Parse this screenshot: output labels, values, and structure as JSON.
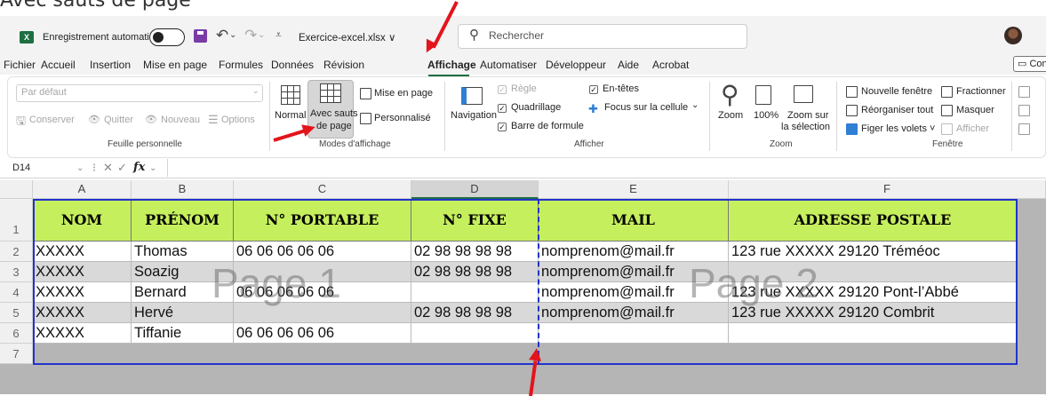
{
  "caption": "Avec sauts de page",
  "titlebar": {
    "app_icon": "X",
    "autosave_label": "Enregistrement automatique",
    "filename": "Exercice-excel.xlsx ∨",
    "search_placeholder": "Rechercher"
  },
  "menu": {
    "items": [
      "Fichier",
      "Accueil",
      "Insertion",
      "Mise en page",
      "Formules",
      "Données",
      "Révision",
      "Affichage",
      "Automatiser",
      "Développeur",
      "Aide",
      "Acrobat"
    ],
    "active": "Affichage",
    "comment_button": "Con"
  },
  "ribbon": {
    "sheet_view": {
      "dropdown_value": "Par défaut",
      "keep": "Conserver",
      "exit": "Quitter",
      "new": "Nouveau",
      "options": "Options",
      "group_label": "Feuille personnelle"
    },
    "workbook_views": {
      "normal": "Normal",
      "page_break_line1": "Avec sauts",
      "page_break_line2": "de page",
      "page_layout": "Mise en page",
      "custom": "Personnalisé",
      "group_label": "Modes d'affichage"
    },
    "show": {
      "navigation": "Navigation",
      "ruler": "Règle",
      "gridlines": "Quadrillage",
      "formula_bar": "Barre de formule",
      "headings": "En-têtes",
      "focus_cell": "Focus sur la cellule",
      "group_label": "Afficher"
    },
    "zoom": {
      "zoom": "Zoom",
      "zoom_100": "100%",
      "zoom_selection_line1": "Zoom sur",
      "zoom_selection_line2": "la sélection",
      "group_label": "Zoom"
    },
    "window": {
      "new_window": "Nouvelle fenêtre",
      "arrange_all": "Réorganiser tout",
      "freeze_panes": "Figer les volets ˅",
      "split": "Fractionner",
      "hide": "Masquer",
      "unhide": "Afficher",
      "group_label": "Fenêtre"
    }
  },
  "formula_bar": {
    "name_box": "D14",
    "fx": "fx"
  },
  "sheet": {
    "columns": [
      "A",
      "B",
      "C",
      "D",
      "E",
      "F"
    ],
    "selected_column": "D",
    "row_numbers": [
      "1",
      "2",
      "3",
      "4",
      "5",
      "6",
      "7"
    ],
    "header_row": [
      "NOM",
      "PRÉNOM",
      "N° PORTABLE",
      "N° FIXE",
      "MAIL",
      "ADRESSE POSTALE"
    ],
    "rows": [
      [
        "XXXXX",
        "Thomas",
        "06 06 06 06 06",
        "02 98 98 98 98",
        "nomprenom@mail.fr",
        "123 rue XXXXX 29120 Tréméoc"
      ],
      [
        "XXXXX",
        "Soazig",
        "",
        "02 98 98 98 98",
        "nomprenom@mail.fr",
        ""
      ],
      [
        "XXXXX",
        "Bernard",
        "06 06 06 06 06",
        "",
        "nomprenom@mail.fr",
        "123 rue XXXXX 29120 Pont-l’Abbé"
      ],
      [
        "XXXXX",
        "Hervé",
        "",
        "02 98 98 98 98",
        "nomprenom@mail.fr",
        "123 rue XXXXX 29120 Combrit"
      ],
      [
        "XXXXX",
        "Tiffanie",
        "06 06 06 06 06",
        "",
        "",
        ""
      ]
    ],
    "page_labels": [
      "Page 1",
      "Page 2"
    ]
  },
  "colors": {
    "header_fill": "#c6ef5e",
    "alt_row_fill": "#d9d9d9",
    "page_border": "#2233cc",
    "arrow": "#e3141b",
    "excel_green": "#1d6f42"
  }
}
